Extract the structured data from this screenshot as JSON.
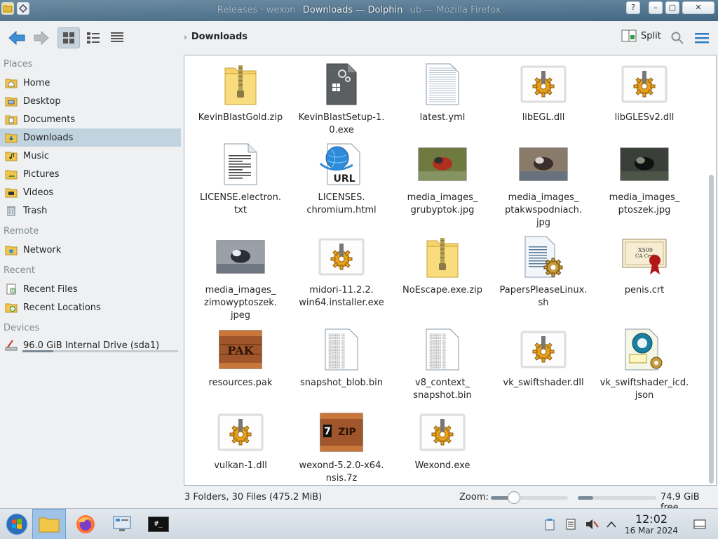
{
  "window": {
    "title_ghost_left": "Releases · wexon",
    "title": "Downloads — Dolphin",
    "title_ghost_right": "ub — Mozilla Firefox",
    "ctrl_help": "?",
    "ctrl_min": "–",
    "ctrl_max": "▢",
    "ctrl_close": "✕"
  },
  "toolbar": {
    "breadcrumb_current": "Downloads",
    "split_label": "Split",
    "icons": [
      "back-arrow",
      "forward-arrow",
      "icons-view",
      "compact-view",
      "details-view",
      "search",
      "hamburger-menu"
    ]
  },
  "sidebar": {
    "sections": {
      "places": "Places",
      "remote": "Remote",
      "recent": "Recent",
      "devices": "Devices"
    },
    "places": [
      {
        "label": "Home"
      },
      {
        "label": "Desktop"
      },
      {
        "label": "Documents"
      },
      {
        "label": "Downloads",
        "selected": true
      },
      {
        "label": "Music"
      },
      {
        "label": "Pictures"
      },
      {
        "label": "Videos"
      },
      {
        "label": "Trash"
      }
    ],
    "remote": [
      {
        "label": "Network"
      }
    ],
    "recent": [
      {
        "label": "Recent Files"
      },
      {
        "label": "Recent Locations"
      }
    ],
    "devices": [
      {
        "label": "96.0 GiB Internal Drive (sda1)",
        "usage_fraction": 0.2
      }
    ]
  },
  "files": [
    {
      "name": "KevinBlastGold.zip",
      "type": "zip"
    },
    {
      "name": "KevinBlastSetup-1.0.exe",
      "type": "exe"
    },
    {
      "name": "latest.yml",
      "type": "text"
    },
    {
      "name": "libEGL.dll",
      "type": "dll"
    },
    {
      "name": "libGLESv2.dll",
      "type": "dll"
    },
    {
      "name": "LICENSE.electron.txt",
      "type": "doc"
    },
    {
      "name": "LICENSES.chromium.html",
      "type": "url"
    },
    {
      "name": "media_images_grubyptok.jpg",
      "type": "image"
    },
    {
      "name": "media_images_ptakwspodniach.jpg",
      "type": "image"
    },
    {
      "name": "media_images_ptoszek.jpg",
      "type": "image"
    },
    {
      "name": "media_images_zimowyptoszek.jpeg",
      "type": "image"
    },
    {
      "name": "midori-11.2.2.win64.installer.exe",
      "type": "dll"
    },
    {
      "name": "NoEscape.exe.zip",
      "type": "zip"
    },
    {
      "name": "PapersPleaseLinux.sh",
      "type": "script"
    },
    {
      "name": "penis.crt",
      "type": "cert"
    },
    {
      "name": "resources.pak",
      "type": "pak"
    },
    {
      "name": "snapshot_blob.bin",
      "type": "bin"
    },
    {
      "name": "v8_context_snapshot.bin",
      "type": "bin"
    },
    {
      "name": "vk_swiftshader.dll",
      "type": "dll"
    },
    {
      "name": "vk_swiftshader_icd.json",
      "type": "json"
    },
    {
      "name": "vulkan-1.dll",
      "type": "dll"
    },
    {
      "name": "wexond-5.2.0-x64.nsis.7z",
      "type": "7z"
    },
    {
      "name": "Wexond.exe",
      "type": "dll"
    }
  ],
  "file_label_lines": [
    [
      "KevinBlastGold.zip"
    ],
    [
      "KevinBlastSetup-1.",
      "0.exe"
    ],
    [
      "latest.yml"
    ],
    [
      "libEGL.dll"
    ],
    [
      "libGLESv2.dll"
    ],
    [
      "LICENSE.electron.",
      "txt"
    ],
    [
      "LICENSES.",
      "chromium.html"
    ],
    [
      "media_images_",
      "grubyptok.jpg"
    ],
    [
      "media_images_",
      "ptakwspodniach.",
      "jpg"
    ],
    [
      "media_images_",
      "ptoszek.jpg"
    ],
    [
      "media_images_",
      "zimowyptoszek.",
      "jpeg"
    ],
    [
      "midori-11.2.2.",
      "win64.installer.exe"
    ],
    [
      "NoEscape.exe.zip"
    ],
    [
      "PapersPleaseLinux.",
      "sh"
    ],
    [
      "penis.crt"
    ],
    [
      "resources.pak"
    ],
    [
      "snapshot_blob.bin"
    ],
    [
      "v8_context_",
      "snapshot.bin"
    ],
    [
      "vk_swiftshader.dll"
    ],
    [
      "vk_swiftshader_icd.",
      "json"
    ],
    [
      "vulkan-1.dll"
    ],
    [
      "wexond-5.2.0-x64.",
      "nsis.7z"
    ],
    [
      "Wexond.exe"
    ]
  ],
  "statusbar": {
    "summary": "3 Folders, 30 Files (475.2 MiB)",
    "zoom_label": "Zoom:",
    "zoom_level_fraction": 0.3,
    "free_space": "74.9 GiB free",
    "free_space_used_fraction": 0.2
  },
  "taskbar": {
    "time": "12:02",
    "date": "16 Mar 2024",
    "tasks": [
      "start",
      "file-manager",
      "firefox",
      "system-settings",
      "terminal"
    ],
    "terminal_glyph": "#_"
  },
  "colors": {
    "selection": "#c2d3e0",
    "accent": "#3daee9",
    "folder": "#f6d36b",
    "zip_stripe": "#9a8a55"
  }
}
